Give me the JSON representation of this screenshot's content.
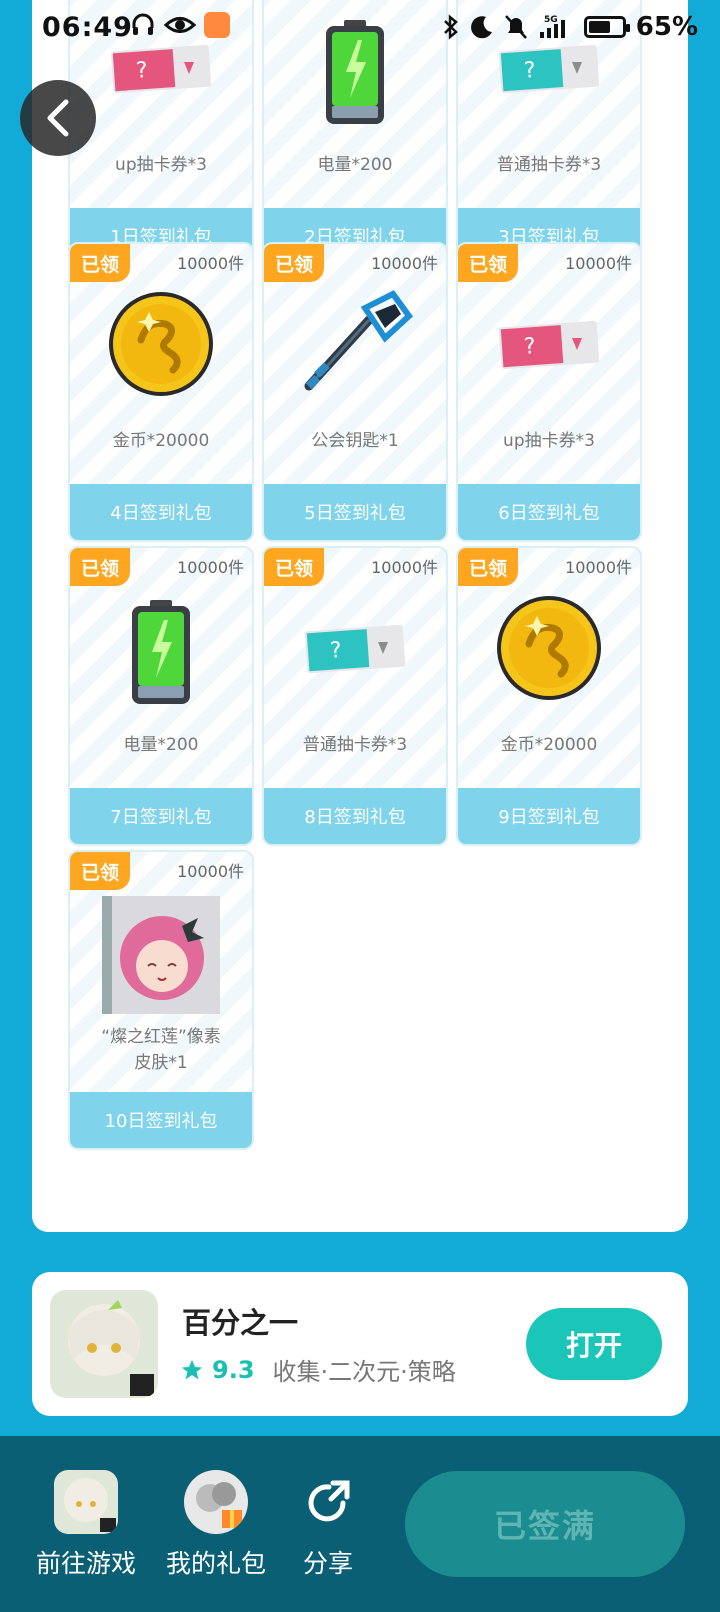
{
  "status": {
    "time": "06:49",
    "battery": "65%",
    "battery_level": 0.65
  },
  "cards": [
    {
      "day_label": "1日签到礼包",
      "item_name": "up抽卡券*3",
      "icon": "limited-ticket-icon",
      "claimed": null,
      "count": null
    },
    {
      "day_label": "2日签到礼包",
      "item_name": "电量*200",
      "icon": "battery-icon",
      "claimed": null,
      "count": null
    },
    {
      "day_label": "3日签到礼包",
      "item_name": "普通抽卡券*3",
      "icon": "normal-ticket-icon",
      "claimed": null,
      "count": null
    },
    {
      "day_label": "4日签到礼包",
      "item_name": "金币*20000",
      "icon": "gold-coin-icon",
      "claimed": "已领",
      "count": "10000件"
    },
    {
      "day_label": "5日签到礼包",
      "item_name": "公会钥匙*1",
      "icon": "guild-key-icon",
      "claimed": "已领",
      "count": "10000件"
    },
    {
      "day_label": "6日签到礼包",
      "item_name": "up抽卡券*3",
      "icon": "limited-ticket-icon",
      "claimed": "已领",
      "count": "10000件"
    },
    {
      "day_label": "7日签到礼包",
      "item_name": "电量*200",
      "icon": "battery-icon",
      "claimed": "已领",
      "count": "10000件"
    },
    {
      "day_label": "8日签到礼包",
      "item_name": "普通抽卡券*3",
      "icon": "normal-ticket-icon",
      "claimed": "已领",
      "count": "10000件"
    },
    {
      "day_label": "9日签到礼包",
      "item_name": "金币*20000",
      "icon": "gold-coin-icon",
      "claimed": "已领",
      "count": "10000件"
    },
    {
      "day_label": "10日签到礼包",
      "item_name": "“燦之红莲”像素皮肤*1",
      "icon": "pixel-skin-portrait-icon",
      "claimed": "已领",
      "count": "10000件"
    }
  ],
  "game": {
    "title": "百分之一",
    "rating": "9.3",
    "tags": "收集·二次元·策略",
    "open_label": "打开"
  },
  "bottom": {
    "goto_game": "前往游戏",
    "my_gifts": "我的礼包",
    "share": "分享",
    "signed_full": "已签满"
  },
  "colors": {
    "page_bg": "#12aad6",
    "card_label_bg": "#7fd3ea",
    "claimed_badge": "#ffa620",
    "accent_teal": "#1bc6b8",
    "bottom_bar": "#0b5f75"
  }
}
